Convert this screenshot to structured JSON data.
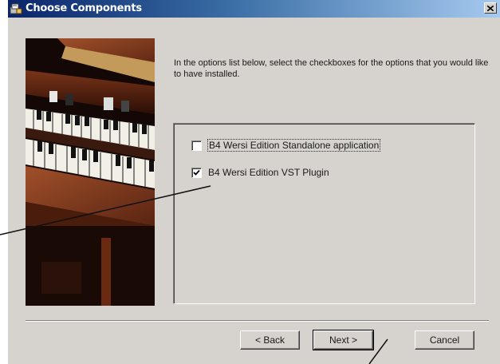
{
  "window": {
    "title": "Choose Components",
    "close_label": "close"
  },
  "instruction": "In the options list below, select the checkboxes for the options that you would like to have installed.",
  "options": [
    {
      "label": "B4 Wersi Edition Standalone application",
      "checked": false
    },
    {
      "label": "B4 Wersi Edition VST Plugin",
      "checked": true
    }
  ],
  "buttons": {
    "back": "< Back",
    "next": "Next >",
    "cancel": "Cancel"
  },
  "icons": {
    "title": "installer-icon",
    "close": "close-icon",
    "check": "checkmark-icon"
  },
  "colors": {
    "titlebar_start": "#0a246a",
    "titlebar_end": "#a6caf0",
    "dialog_face": "#d6d3ce"
  }
}
